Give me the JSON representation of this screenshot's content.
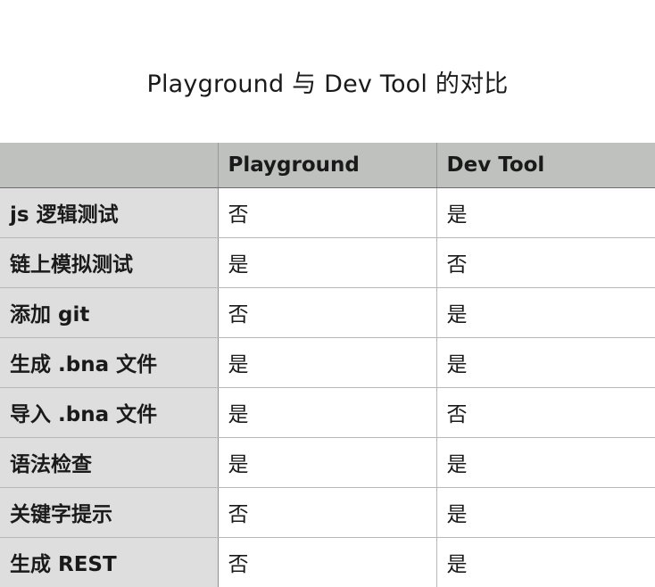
{
  "title": "Playground 与 Dev Tool 的对比",
  "table": {
    "headers": [
      "",
      "Playground",
      "Dev Tool"
    ],
    "rows": [
      {
        "feature": "js 逻辑测试",
        "playground": "否",
        "devtool": "是"
      },
      {
        "feature": "链上模拟测试",
        "playground": "是",
        "devtool": "否"
      },
      {
        "feature": "添加 git",
        "playground": "否",
        "devtool": "是"
      },
      {
        "feature": "生成 .bna 文件",
        "playground": "是",
        "devtool": "是"
      },
      {
        "feature": "导入 .bna 文件",
        "playground": "是",
        "devtool": "否"
      },
      {
        "feature": "语法检查",
        "playground": "是",
        "devtool": "是"
      },
      {
        "feature": "关键字提示",
        "playground": "否",
        "devtool": "是"
      },
      {
        "feature": "生成 REST",
        "playground": "否",
        "devtool": "是"
      }
    ]
  }
}
